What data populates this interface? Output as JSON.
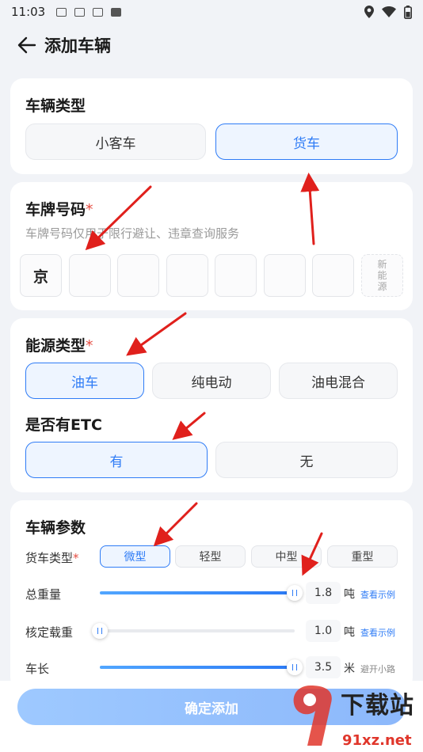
{
  "status_bar": {
    "time": "11:03",
    "notif_icons": [
      "mail-icon",
      "mail-icon",
      "mail-icon",
      "a-icon"
    ],
    "right_icons": [
      "location-icon",
      "wifi-icon",
      "battery-icon"
    ]
  },
  "nav": {
    "title": "添加车辆"
  },
  "vehicle_type": {
    "title": "车辆类型",
    "options": [
      "小客车",
      "货车"
    ],
    "selected": "货车"
  },
  "plate": {
    "title": "车牌号码",
    "required_mark": "*",
    "hint": "车牌号码仅用于限行避让、违章查询服务",
    "province": "京",
    "new_energy": [
      "新",
      "能",
      "源"
    ]
  },
  "energy_type": {
    "title": "能源类型",
    "required_mark": "*",
    "options": [
      "油车",
      "纯电动",
      "油电混合"
    ],
    "selected": "油车"
  },
  "etc": {
    "title": "是否有ETC",
    "options": [
      "有",
      "无"
    ],
    "selected": "有"
  },
  "params": {
    "title": "车辆参数",
    "truck_type_label": "货车类型",
    "required_mark": "*",
    "truck_types": [
      "微型",
      "轻型",
      "中型",
      "重型"
    ],
    "selected_truck_type": "微型",
    "sliders": [
      {
        "label": "总重量",
        "value": "1.8",
        "unit": "吨",
        "link": "查看示例",
        "fill_fraction": 1.0
      },
      {
        "label": "核定载重",
        "value": "1.0",
        "unit": "吨",
        "link": "查看示例",
        "fill_fraction": 0.0
      },
      {
        "label": "车长",
        "value": "3.5",
        "unit": "米",
        "link": "避开小路",
        "fill_fraction": 1.0
      }
    ]
  },
  "confirm": {
    "label": "确定添加"
  },
  "watermark": {
    "brand": "下载站",
    "site": "91xz.net"
  },
  "colors": {
    "accent": "#2f7cf6",
    "required": "#e54d42",
    "annotation_arrow": "#e0201c"
  }
}
